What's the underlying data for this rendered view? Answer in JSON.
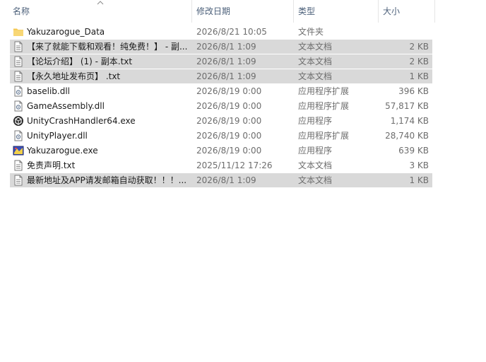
{
  "columns": {
    "name": "名称",
    "date": "修改日期",
    "type": "类型",
    "size": "大小"
  },
  "files": [
    {
      "name": "Yakuzarogue_Data",
      "date": "2026/8/21 10:05",
      "type": "文件夹",
      "size": "",
      "icon": "folder-icon",
      "selected": false
    },
    {
      "name": "【来了就能下载和观看！纯免费！】 - 副...",
      "date": "2026/8/1 1:09",
      "type": "文本文档",
      "size": "2 KB",
      "icon": "text-file-icon",
      "selected": true
    },
    {
      "name": "【论坛介绍】 (1) - 副本.txt",
      "date": "2026/8/1 1:09",
      "type": "文本文档",
      "size": "2 KB",
      "icon": "text-file-icon",
      "selected": true
    },
    {
      "name": "【永久地址发布页】 .txt",
      "date": "2026/8/1 1:09",
      "type": "文本文档",
      "size": "1 KB",
      "icon": "text-file-icon",
      "selected": true
    },
    {
      "name": "baselib.dll",
      "date": "2026/8/19 0:00",
      "type": "应用程序扩展",
      "size": "396 KB",
      "icon": "dll-file-icon",
      "selected": false
    },
    {
      "name": "GameAssembly.dll",
      "date": "2026/8/19 0:00",
      "type": "应用程序扩展",
      "size": "57,817 KB",
      "icon": "dll-file-icon",
      "selected": false
    },
    {
      "name": "UnityCrashHandler64.exe",
      "date": "2026/8/19 0:00",
      "type": "应用程序",
      "size": "1,174 KB",
      "icon": "unity-exe-icon",
      "selected": false
    },
    {
      "name": "UnityPlayer.dll",
      "date": "2026/8/19 0:00",
      "type": "应用程序扩展",
      "size": "28,740 KB",
      "icon": "dll-file-icon",
      "selected": false
    },
    {
      "name": "Yakuzarogue.exe",
      "date": "2026/8/19 0:00",
      "type": "应用程序",
      "size": "639 KB",
      "icon": "game-exe-icon",
      "selected": false
    },
    {
      "name": "免责声明.txt",
      "date": "2025/11/12 17:26",
      "type": "文本文档",
      "size": "3 KB",
      "icon": "text-file-icon",
      "selected": false
    },
    {
      "name": "最新地址及APP请发邮箱自动获取！！！...",
      "date": "2026/8/1 1:09",
      "type": "文本文档",
      "size": "1 KB",
      "icon": "text-file-icon",
      "selected": true
    }
  ]
}
